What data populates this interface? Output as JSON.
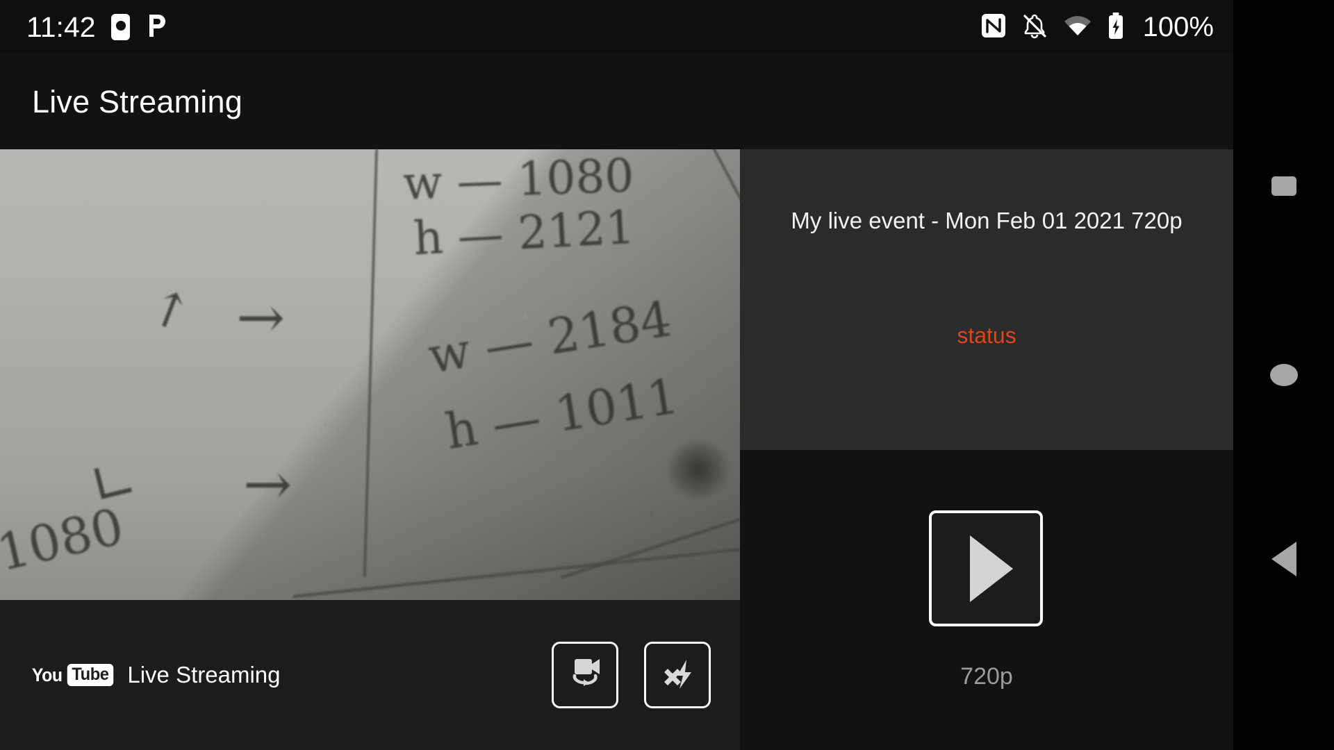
{
  "status_bar": {
    "clock": "11:42",
    "battery_percent": "100%",
    "icons": [
      "moon-dnd-icon",
      "pushbullet-icon",
      "nfc-icon",
      "notifications-muted-icon",
      "wifi-icon",
      "battery-charging-icon"
    ]
  },
  "title_bar": {
    "title": "Live Streaming"
  },
  "camera": {
    "preview_alt": "camera-preview-whiteboard-notes",
    "preview_notes": [
      "w  —  1080",
      "h  —  2121",
      "w  —  2184",
      "h  —  1011",
      "1080"
    ],
    "brand": {
      "logo_you": "You",
      "logo_tube": "Tube",
      "label": "Live Streaming"
    },
    "controls": [
      {
        "name": "switch-camera-button",
        "icon": "camera-switch-icon"
      },
      {
        "name": "flash-toggle-button",
        "icon": "flash-off-icon"
      }
    ]
  },
  "event_panel": {
    "title": "My live event - Mon Feb 01 2021 720p",
    "status": "status",
    "status_color": "#dd4617"
  },
  "player_panel": {
    "play_button_label": "play-button",
    "quality": "720p"
  },
  "nav_bar": {
    "items": [
      {
        "name": "recents-button",
        "icon": "square-icon"
      },
      {
        "name": "home-button",
        "icon": "circle-icon"
      },
      {
        "name": "back-button",
        "icon": "triangle-left-icon"
      }
    ]
  }
}
